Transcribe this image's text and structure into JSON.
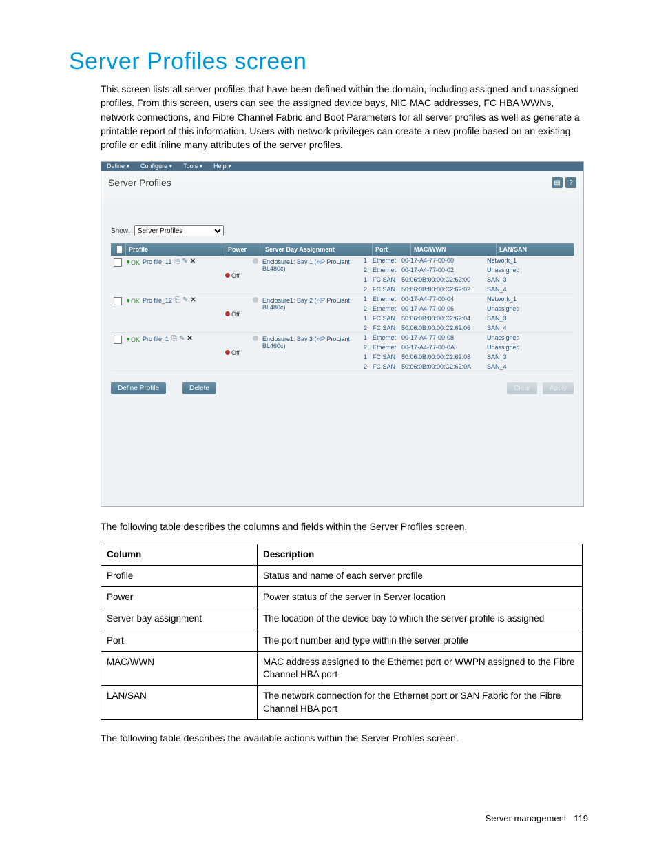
{
  "page": {
    "title": "Server Profiles screen",
    "intro": "This screen lists all server profiles that have been defined within the domain, including assigned and unassigned profiles. From this screen, users can see the assigned device bays, NIC MAC addresses, FC HBA WWNs, network connections, and Fibre Channel Fabric and Boot Parameters for all server profiles as well as generate a printable report of this information. Users with network privileges can create a new profile based on an existing profile or edit inline many attributes of the server profiles.",
    "desc_intro": "The following table describes the columns and fields within the Server Profiles screen.",
    "actions_intro": "The following table describes the available actions within the Server Profiles screen.",
    "footer_label": "Server management",
    "footer_page": "119"
  },
  "screenshot": {
    "menu": [
      "Define ▾",
      "Configure ▾",
      "Tools ▾",
      "Help ▾"
    ],
    "title": "Server Profiles",
    "show_label": "Show:",
    "show_value": "Server Profiles",
    "headers": {
      "profile": "Profile",
      "power": "Power",
      "bay": "Server Bay Assignment",
      "port": "Port",
      "mac": "MAC/WWN",
      "lan": "LAN/SAN"
    },
    "status_ok": "OK",
    "off": "Off",
    "profiles": [
      {
        "name": "Pro file_11",
        "bay": "Enclosure1: Bay 1 (HP ProLiant BL480c)",
        "ports": [
          {
            "n": "1",
            "t": "Ethernet",
            "m": "00-17-A4-77-00-00",
            "l": "Network_1"
          },
          {
            "n": "2",
            "t": "Ethernet",
            "m": "00-17-A4-77-00-02",
            "l": "Unassigned"
          },
          {
            "n": "1",
            "t": "FC SAN",
            "m": "50:06:0B:00:00:C2:62:00",
            "l": "SAN_3"
          },
          {
            "n": "2",
            "t": "FC SAN",
            "m": "50:06:0B:00:00:C2:62:02",
            "l": "SAN_4"
          }
        ]
      },
      {
        "name": "Pro file_12",
        "bay": "Enclosure1: Bay 2 (HP ProLiant BL480c)",
        "ports": [
          {
            "n": "1",
            "t": "Ethernet",
            "m": "00-17-A4-77-00-04",
            "l": "Network_1"
          },
          {
            "n": "2",
            "t": "Ethernet",
            "m": "00-17-A4-77-00-06",
            "l": "Unassigned"
          },
          {
            "n": "1",
            "t": "FC SAN",
            "m": "50:06:0B:00:00:C2:62:04",
            "l": "SAN_3"
          },
          {
            "n": "2",
            "t": "FC SAN",
            "m": "50:06:0B:00:00:C2:62:06",
            "l": "SAN_4"
          }
        ]
      },
      {
        "name": "Pro file_1",
        "bay": "Enclosure1: Bay 3 (HP ProLiant BL460c)",
        "ports": [
          {
            "n": "1",
            "t": "Ethernet",
            "m": "00-17-A4-77-00-08",
            "l": "Unassigned"
          },
          {
            "n": "2",
            "t": "Ethernet",
            "m": "00-17-A4-77-00-0A",
            "l": "Unassigned"
          },
          {
            "n": "1",
            "t": "FC SAN",
            "m": "50:06:0B:00:00:C2:62:08",
            "l": "SAN_3"
          },
          {
            "n": "2",
            "t": "FC SAN",
            "m": "50:06:0B:00:00:C2:62:0A",
            "l": "SAN_4"
          }
        ]
      }
    ],
    "actions": {
      "define": "Define Profile",
      "delete": "Delete",
      "clear": "Clear",
      "apply": "Apply"
    }
  },
  "desc_table": {
    "h1": "Column",
    "h2": "Description",
    "rows": [
      {
        "c": "Profile",
        "d": "Status and name of each server profile"
      },
      {
        "c": "Power",
        "d": "Power status of the server in Server location"
      },
      {
        "c": "Server bay assignment",
        "d": "The location of the device bay to which the server profile is assigned"
      },
      {
        "c": "Port",
        "d": "The port number and type within the server profile"
      },
      {
        "c": "MAC/WWN",
        "d": "MAC address assigned to the Ethernet port or WWPN assigned to the Fibre Channel HBA port"
      },
      {
        "c": "LAN/SAN",
        "d": "The network connection for the Ethernet port or SAN Fabric for the Fibre Channel HBA port"
      }
    ]
  }
}
